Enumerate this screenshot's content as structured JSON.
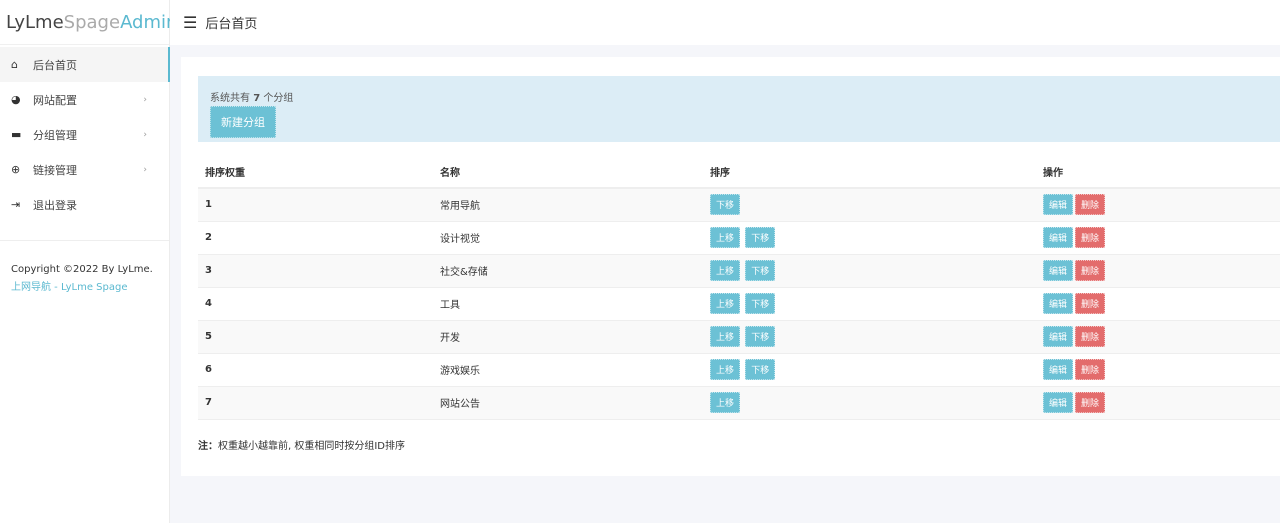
{
  "logo": {
    "part1": "LyLme",
    "part2": "Spage",
    "part3": "Admin"
  },
  "sidebar": {
    "items": [
      {
        "label": "后台首页",
        "icon": "home-icon",
        "glyph": "⌂",
        "active": true,
        "chevron": false
      },
      {
        "label": "网站配置",
        "icon": "palette-icon",
        "glyph": "◕",
        "chevron": true
      },
      {
        "label": "分组管理",
        "icon": "folder-icon",
        "glyph": "▬",
        "chevron": true
      },
      {
        "label": "链接管理",
        "icon": "globe-icon",
        "glyph": "⊕",
        "chevron": true
      },
      {
        "label": "退出登录",
        "icon": "logout-icon",
        "glyph": "⇥",
        "chevron": false
      }
    ],
    "copyright": "Copyright ©2022 By LyLme.",
    "link": "上网导航 - LyLme Spage"
  },
  "header": {
    "title": "后台首页"
  },
  "alert": {
    "prefix": "系统共有 ",
    "count": "7",
    "suffix": " 个分组",
    "new_button": "新建分组"
  },
  "table": {
    "headers": [
      "排序权重",
      "名称",
      "排序",
      "操作"
    ],
    "rows": [
      {
        "weight": "1",
        "name": "常用导航",
        "up": false,
        "down": true
      },
      {
        "weight": "2",
        "name": "设计视觉",
        "up": true,
        "down": true
      },
      {
        "weight": "3",
        "name": "社交&存储",
        "up": true,
        "down": true
      },
      {
        "weight": "4",
        "name": "工具",
        "up": true,
        "down": true
      },
      {
        "weight": "5",
        "name": "开发",
        "up": true,
        "down": true
      },
      {
        "weight": "6",
        "name": "游戏娱乐",
        "up": true,
        "down": true
      },
      {
        "weight": "7",
        "name": "网站公告",
        "up": true,
        "down": false
      }
    ],
    "labels": {
      "up": "上移",
      "down": "下移",
      "edit": "编辑",
      "delete": "删除"
    }
  },
  "note": {
    "bold": "注：",
    "text": "权重越小越靠前, 权重相同时按分组ID排序"
  },
  "colors": {
    "accent": "#6cc1d5",
    "danger": "#e36c6c",
    "alert_bg": "#dcedf6"
  }
}
